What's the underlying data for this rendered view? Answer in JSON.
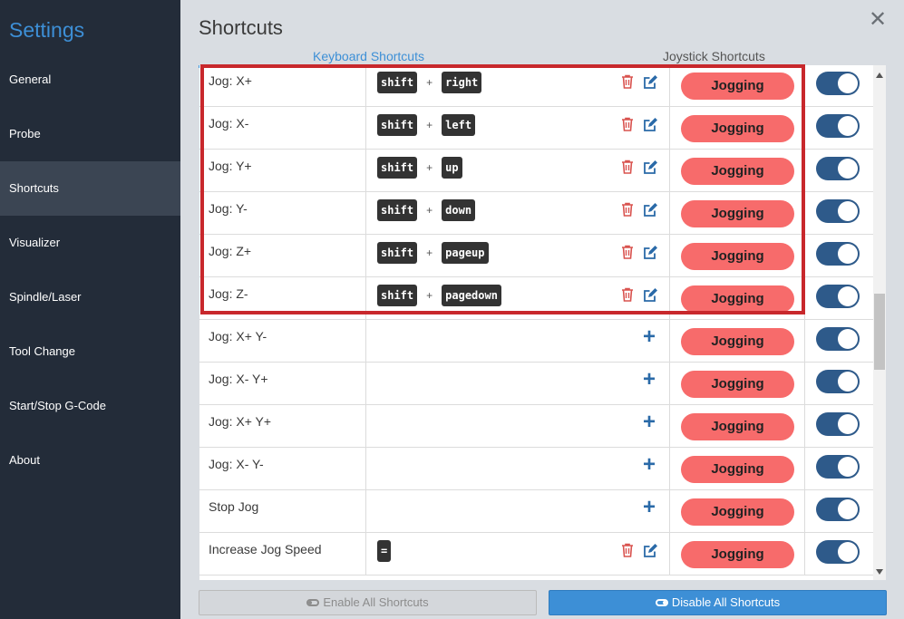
{
  "sidebar": {
    "title": "Settings",
    "items": [
      {
        "label": "General"
      },
      {
        "label": "Probe"
      },
      {
        "label": "Shortcuts"
      },
      {
        "label": "Visualizer"
      },
      {
        "label": "Spindle/Laser"
      },
      {
        "label": "Tool Change"
      },
      {
        "label": "Start/Stop G-Code"
      },
      {
        "label": "About"
      }
    ],
    "active_index": 2
  },
  "header": {
    "title": "Shortcuts",
    "close_icon": "close-icon"
  },
  "tabs": [
    {
      "label": "Keyboard Shortcuts",
      "active": true
    },
    {
      "label": "Joystick Shortcuts",
      "active": false
    }
  ],
  "shortcuts": [
    {
      "name": "Jog: X+",
      "keys": [
        "shift",
        "right"
      ],
      "category": "Jogging",
      "enabled": true
    },
    {
      "name": "Jog: X-",
      "keys": [
        "shift",
        "left"
      ],
      "category": "Jogging",
      "enabled": true
    },
    {
      "name": "Jog: Y+",
      "keys": [
        "shift",
        "up"
      ],
      "category": "Jogging",
      "enabled": true
    },
    {
      "name": "Jog: Y-",
      "keys": [
        "shift",
        "down"
      ],
      "category": "Jogging",
      "enabled": true
    },
    {
      "name": "Jog: Z+",
      "keys": [
        "shift",
        "pageup"
      ],
      "category": "Jogging",
      "enabled": true
    },
    {
      "name": "Jog: Z-",
      "keys": [
        "shift",
        "pagedown"
      ],
      "category": "Jogging",
      "enabled": true
    },
    {
      "name": "Jog: X+ Y-",
      "keys": [],
      "category": "Jogging",
      "enabled": true
    },
    {
      "name": "Jog: X- Y+",
      "keys": [],
      "category": "Jogging",
      "enabled": true
    },
    {
      "name": "Jog: X+ Y+",
      "keys": [],
      "category": "Jogging",
      "enabled": true
    },
    {
      "name": "Jog: X- Y-",
      "keys": [],
      "category": "Jogging",
      "enabled": true
    },
    {
      "name": "Stop Jog",
      "keys": [],
      "category": "Jogging",
      "enabled": true
    },
    {
      "name": "Increase Jog Speed",
      "keys": [
        "="
      ],
      "category": "Jogging",
      "enabled": true
    }
  ],
  "key_separator": "+",
  "footer": {
    "enable_all_label": "Enable All Shortcuts",
    "disable_all_label": "Disable All Shortcuts"
  },
  "colors": {
    "accent": "#3d8fd6",
    "category_pill": "#f76b6b",
    "toggle_on": "#2e5a8a",
    "delete_icon": "#d9534f",
    "edit_icon": "#2a6aa8",
    "highlight_box": "#c8282c"
  }
}
